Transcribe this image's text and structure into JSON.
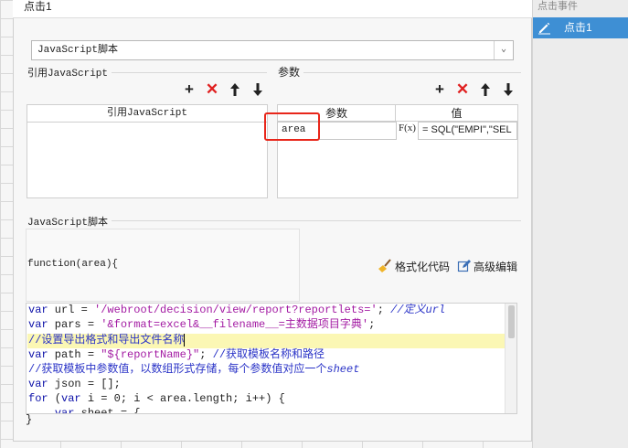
{
  "dialog": {
    "title": "点击1"
  },
  "right_panel": {
    "header": "点击事件",
    "selected_event": "点击1"
  },
  "script_type": {
    "selected": "JavaScript脚本"
  },
  "ref_js": {
    "section_label": "引用JavaScript",
    "column_header": "引用JavaScript"
  },
  "params": {
    "section_label": "参数",
    "col_param": "参数",
    "col_value": "值",
    "row": {
      "name": "area",
      "fx": "F(x)",
      "value": "= SQL(\"EMPI\",\"SEL"
    }
  },
  "toolbar": {
    "add": "+",
    "delete": "✕",
    "up": "🡑",
    "down": "🡓"
  },
  "script": {
    "section_label": "JavaScript脚本",
    "signature": "function(area){",
    "format_label": "格式化代码",
    "advanced_label": "高级编辑",
    "closing": "}"
  },
  "code": {
    "l1_kw": "var",
    "l1_a": " url = ",
    "l1_str": "'/webroot/decision/view/report?reportlets='",
    "l1_b": "; ",
    "l1_cm": "//定义url",
    "l2_kw": "var",
    "l2_a": " pars = ",
    "l2_str": "'&format=excel&__filename__=主数据项目字典'",
    "l2_b": ";",
    "l3_cm": "//设置导出格式和导出文件名称",
    "l4_kw": "var",
    "l4_a": " path = ",
    "l4_str": "\"${reportName}\"",
    "l4_b": "; ",
    "l4_cm": "//获取模板名称和路径",
    "l5_cm": "//获取模板中参数值，以数组形式存储，每个参数值对应一个",
    "l5_cmi": "sheet",
    "l6_kw": "var",
    "l6_a": " json = [];",
    "l7_kw": "for",
    "l7_a": " (",
    "l7_kw2": "var",
    "l7_b": " i = 0; i < area.length; i++) {",
    "l8_a": "    ",
    "l8_kw": "var",
    "l8_b": " sheet = {"
  },
  "colors": {
    "accent": "#3e8fd4",
    "delete_red": "#e02020",
    "highlight_box": "#e8261a",
    "line_highlight": "#fbf7b4"
  }
}
